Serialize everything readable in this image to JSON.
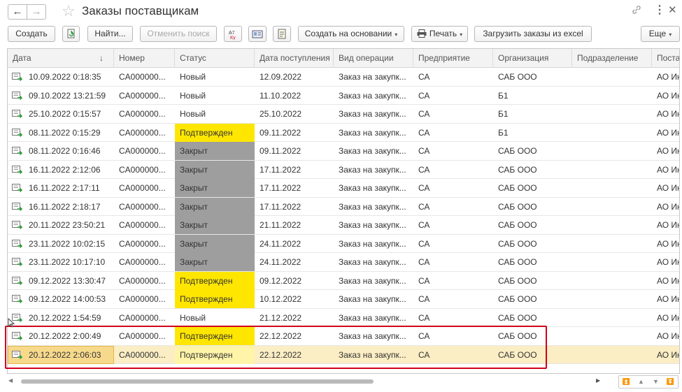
{
  "window": {
    "title": "Заказы поставщикам"
  },
  "nav": {
    "back": "←",
    "forward": "→",
    "star": "☆",
    "link": "🔗",
    "more": "⋮",
    "close": "✕"
  },
  "toolbar": {
    "create": "Создать",
    "find": "Найти...",
    "cancel_search": "Отменить поиск",
    "create_based_on": "Создать на основании",
    "print": "Печать",
    "load_excel": "Загрузить заказы из excel",
    "more": "Еще",
    "caret": "▾"
  },
  "columns": [
    "Дата",
    "Номер",
    "Статус",
    "Дата поступления",
    "Вид операции",
    "Предприятие",
    "Организация",
    "Подразделение",
    "Поста"
  ],
  "sort_arrow": "↓",
  "rows": [
    {
      "date": "10.09.2022 0:18:35",
      "number": "CA000000...",
      "status": "Новый",
      "arrival": "12.09.2022",
      "operation": "Заказ на закупк...",
      "enterprise": "СА",
      "organization": "САБ ООО",
      "division": "",
      "supplier": "АО Ин"
    },
    {
      "date": "09.10.2022 13:21:59",
      "number": "CA000000...",
      "status": "Новый",
      "arrival": "11.10.2022",
      "operation": "Заказ на закупк...",
      "enterprise": "СА",
      "organization": "Б1",
      "division": "",
      "supplier": "АО Ин"
    },
    {
      "date": "25.10.2022 0:15:57",
      "number": "CA000000...",
      "status": "Новый",
      "arrival": "25.10.2022",
      "operation": "Заказ на закупк...",
      "enterprise": "СА",
      "organization": "Б1",
      "division": "",
      "supplier": "АО Ин"
    },
    {
      "date": "08.11.2022 0:15:29",
      "number": "CA000000...",
      "status": "Подтвержден",
      "arrival": "09.11.2022",
      "operation": "Заказ на закупк...",
      "enterprise": "СА",
      "organization": "Б1",
      "division": "",
      "supplier": "АО Ин"
    },
    {
      "date": "08.11.2022 0:16:46",
      "number": "CA000000...",
      "status": "Закрыт",
      "arrival": "09.11.2022",
      "operation": "Заказ на закупк...",
      "enterprise": "СА",
      "organization": "САБ ООО",
      "division": "",
      "supplier": "АО Ин"
    },
    {
      "date": "16.11.2022 2:12:06",
      "number": "CA000000...",
      "status": "Закрыт",
      "arrival": "17.11.2022",
      "operation": "Заказ на закупк...",
      "enterprise": "СА",
      "organization": "САБ ООО",
      "division": "",
      "supplier": "АО Ин"
    },
    {
      "date": "16.11.2022 2:17:11",
      "number": "CA000000...",
      "status": "Закрыт",
      "arrival": "17.11.2022",
      "operation": "Заказ на закупк...",
      "enterprise": "СА",
      "organization": "САБ ООО",
      "division": "",
      "supplier": "АО Ин"
    },
    {
      "date": "16.11.2022 2:18:17",
      "number": "CA000000...",
      "status": "Закрыт",
      "arrival": "17.11.2022",
      "operation": "Заказ на закупк...",
      "enterprise": "СА",
      "organization": "САБ ООО",
      "division": "",
      "supplier": "АО Ин"
    },
    {
      "date": "20.11.2022 23:50:21",
      "number": "CA000000...",
      "status": "Закрыт",
      "arrival": "21.11.2022",
      "operation": "Заказ на закупк...",
      "enterprise": "СА",
      "organization": "САБ ООО",
      "division": "",
      "supplier": "АО Ин"
    },
    {
      "date": "23.11.2022 10:02:15",
      "number": "CA000000...",
      "status": "Закрыт",
      "arrival": "24.11.2022",
      "operation": "Заказ на закупк...",
      "enterprise": "СА",
      "organization": "САБ ООО",
      "division": "",
      "supplier": "АО Ин"
    },
    {
      "date": "23.11.2022 10:17:10",
      "number": "CA000000...",
      "status": "Закрыт",
      "arrival": "24.11.2022",
      "operation": "Заказ на закупк...",
      "enterprise": "СА",
      "organization": "САБ ООО",
      "division": "",
      "supplier": "АО Ин"
    },
    {
      "date": "09.12.2022 13:30:47",
      "number": "CA000000...",
      "status": "Подтвержден",
      "arrival": "09.12.2022",
      "operation": "Заказ на закупк...",
      "enterprise": "СА",
      "organization": "САБ ООО",
      "division": "",
      "supplier": "АО Ин"
    },
    {
      "date": "09.12.2022 14:00:53",
      "number": "CA000000...",
      "status": "Подтвержден",
      "arrival": "10.12.2022",
      "operation": "Заказ на закупк...",
      "enterprise": "СА",
      "organization": "САБ ООО",
      "division": "",
      "supplier": "АО Ин"
    },
    {
      "date": "20.12.2022 1:54:59",
      "number": "CA000000...",
      "status": "Новый",
      "arrival": "21.12.2022",
      "operation": "Заказ на закупк...",
      "enterprise": "СА",
      "organization": "САБ ООО",
      "division": "",
      "supplier": "АО Ин"
    },
    {
      "date": "20.12.2022 2:00:49",
      "number": "CA000000...",
      "status": "Подтвержден",
      "arrival": "22.12.2022",
      "operation": "Заказ на закупк...",
      "enterprise": "СА",
      "organization": "САБ ООО",
      "division": "",
      "supplier": "АО Ин"
    },
    {
      "date": "20.12.2022 2:06:03",
      "number": "CA000000...",
      "status": "Подтвержден",
      "arrival": "22.12.2022",
      "operation": "Заказ на закупк...",
      "enterprise": "СА",
      "organization": "САБ ООО",
      "division": "",
      "supplier": "АО Ин",
      "selected": true
    }
  ],
  "status_colors": {
    "Подтвержден": "#ffe600",
    "Закрыт": "#9e9e9e"
  },
  "icons": {
    "refresh": "refresh-icon",
    "attributes": "attributes-icon",
    "card": "card-icon",
    "report": "report-icon",
    "printer": "printer-icon",
    "document": "document-icon"
  }
}
